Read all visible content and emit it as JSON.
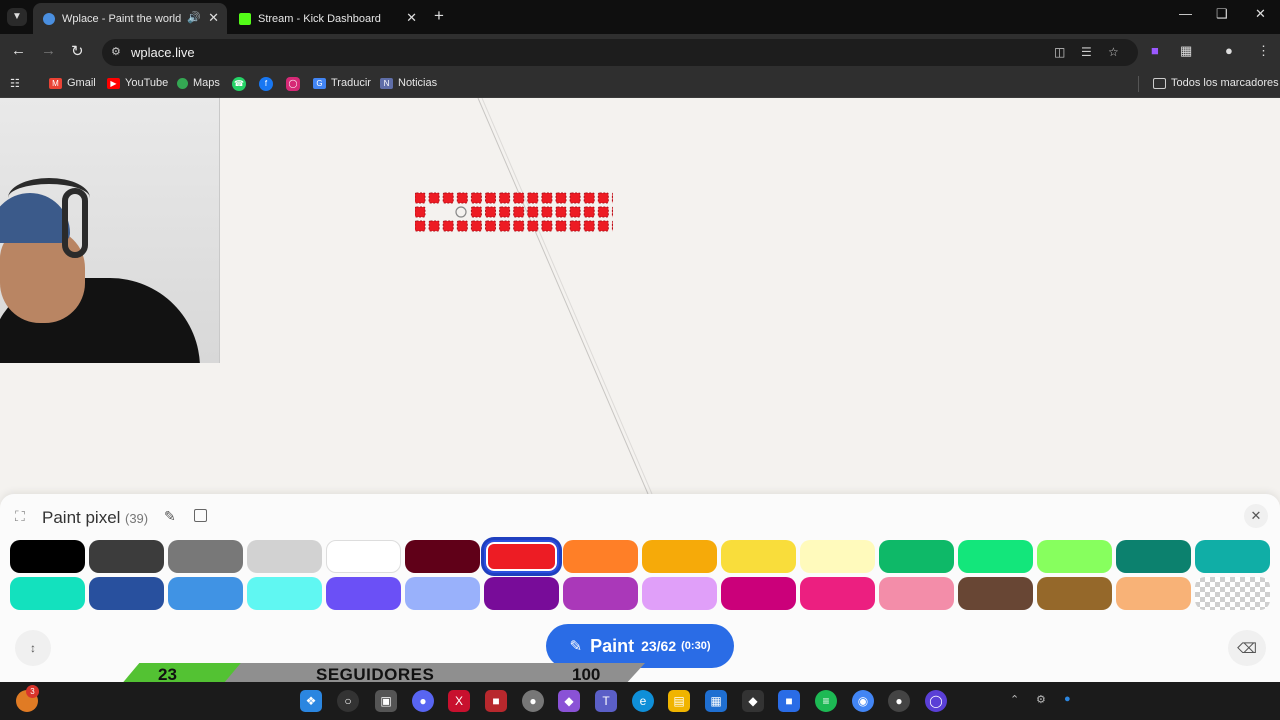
{
  "browser": {
    "tab_menu_icon": "chevron-down-icon",
    "tabs": [
      {
        "title": "Wplace - Paint the world",
        "favicon": "globe-icon",
        "active": true,
        "audio": "speaker-icon"
      },
      {
        "title": "Stream - Kick Dashboard",
        "favicon": "kick-icon",
        "active": false
      }
    ],
    "url": "wplace.live",
    "bookmarks": [
      "Gmail",
      "YouTube",
      "Maps",
      "Traducir",
      "Noticias"
    ],
    "all_bookmarks": "Todos los marcadores"
  },
  "panel": {
    "title": "Paint pixel",
    "count": "(39)",
    "palette": [
      {
        "color": "#000000",
        "selected": false
      },
      {
        "color": "#3c3c3c",
        "selected": false
      },
      {
        "color": "#787878",
        "selected": false
      },
      {
        "color": "#d2d2d2",
        "selected": false
      },
      {
        "color": "#ffffff",
        "selected": false
      },
      {
        "color": "#600018",
        "selected": false
      },
      {
        "color": "#ed1c24",
        "selected": true
      },
      {
        "color": "#ff7f27",
        "selected": false
      },
      {
        "color": "#f6aa09",
        "selected": false
      },
      {
        "color": "#f9dd3b",
        "selected": false
      },
      {
        "color": "#fffabc",
        "selected": false
      },
      {
        "color": "#0eb968",
        "selected": false
      },
      {
        "color": "#13e67b",
        "selected": false
      },
      {
        "color": "#87ff5e",
        "selected": false
      },
      {
        "color": "#0c816e",
        "selected": false
      },
      {
        "color": "#10aea6",
        "selected": false
      },
      {
        "color": "#13e1be",
        "selected": false
      },
      {
        "color": "#28509e",
        "selected": false
      },
      {
        "color": "#4093e4",
        "selected": false
      },
      {
        "color": "#60f7f2",
        "selected": false
      },
      {
        "color": "#6b50f6",
        "selected": false
      },
      {
        "color": "#99b1fb",
        "selected": false
      },
      {
        "color": "#780c99",
        "selected": false
      },
      {
        "color": "#aa38b9",
        "selected": false
      },
      {
        "color": "#e09ff9",
        "selected": false
      },
      {
        "color": "#cb007a",
        "selected": false
      },
      {
        "color": "#ec1f80",
        "selected": false
      },
      {
        "color": "#f38da9",
        "selected": false
      },
      {
        "color": "#684634",
        "selected": false
      },
      {
        "color": "#95682a",
        "selected": false
      },
      {
        "color": "#f8b277",
        "selected": false
      },
      {
        "color": "transparent",
        "selected": false
      }
    ],
    "paint_button": {
      "label": "Paint",
      "charges": "23/62",
      "timer": "(0:30)"
    }
  },
  "goal_overlay": {
    "current": "23",
    "label": "SEGUIDORES",
    "goal": "100",
    "progress": 0.23
  },
  "taskbar": {
    "notification_badge": "3"
  }
}
